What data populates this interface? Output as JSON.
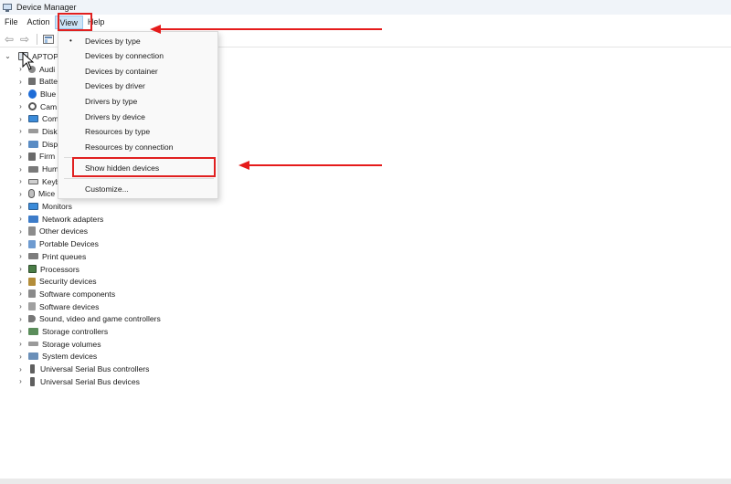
{
  "window": {
    "title": "Device Manager",
    "icon": "device-manager-icon"
  },
  "menubar": [
    {
      "label": "File",
      "active": false
    },
    {
      "label": "Action",
      "active": false
    },
    {
      "label": "View",
      "active": true
    },
    {
      "label": "Help",
      "active": false
    }
  ],
  "toolbar": [
    {
      "icon": "back-arrow-icon",
      "glyph": "⇦"
    },
    {
      "icon": "forward-arrow-icon",
      "glyph": "⇨"
    },
    {
      "icon": "properties-icon",
      "glyph": ""
    }
  ],
  "tree": {
    "root": {
      "label": "LAPTOP",
      "visible_label": "APTOP",
      "expanded": true,
      "icon": "computer-icon"
    },
    "children": [
      {
        "label": "Audi",
        "icon": "audio-icon"
      },
      {
        "label": "Batte",
        "icon": "battery-icon"
      },
      {
        "label": "Blue",
        "icon": "bluetooth-icon"
      },
      {
        "label": "Cam",
        "icon": "camera-icon"
      },
      {
        "label": "Com",
        "icon": "computer-icon"
      },
      {
        "label": "Disk",
        "icon": "disk-drive-icon"
      },
      {
        "label": "Disp",
        "icon": "display-adapter-icon"
      },
      {
        "label": "Firm",
        "icon": "firmware-icon"
      },
      {
        "label": "Hum",
        "icon": "hid-icon"
      },
      {
        "label": "Keyb",
        "icon": "keyboard-icon"
      },
      {
        "label": "Mice",
        "icon": "mouse-icon"
      },
      {
        "label": "Monitors",
        "icon": "monitor-icon"
      },
      {
        "label": "Network adapters",
        "icon": "network-adapter-icon"
      },
      {
        "label": "Other devices",
        "icon": "other-devices-icon"
      },
      {
        "label": "Portable Devices",
        "icon": "portable-device-icon"
      },
      {
        "label": "Print queues",
        "icon": "printer-icon"
      },
      {
        "label": "Processors",
        "icon": "processor-icon"
      },
      {
        "label": "Security devices",
        "icon": "security-device-icon"
      },
      {
        "label": "Software components",
        "icon": "software-component-icon"
      },
      {
        "label": "Software devices",
        "icon": "software-device-icon"
      },
      {
        "label": "Sound, video and game controllers",
        "icon": "sound-icon"
      },
      {
        "label": "Storage controllers",
        "icon": "storage-controller-icon"
      },
      {
        "label": "Storage volumes",
        "icon": "storage-volume-icon"
      },
      {
        "label": "System devices",
        "icon": "system-device-icon"
      },
      {
        "label": "Universal Serial Bus controllers",
        "icon": "usb-icon"
      },
      {
        "label": "Universal Serial Bus devices",
        "icon": "usb-icon"
      }
    ]
  },
  "view_menu": {
    "items": [
      {
        "label": "Devices by type",
        "checked": true
      },
      {
        "label": "Devices by connection",
        "checked": false
      },
      {
        "label": "Devices by container",
        "checked": false
      },
      {
        "label": "Devices by driver",
        "checked": false
      },
      {
        "label": "Drivers by type",
        "checked": false
      },
      {
        "label": "Drivers by device",
        "checked": false
      },
      {
        "label": "Resources by type",
        "checked": false
      },
      {
        "label": "Resources by connection",
        "checked": false
      },
      {
        "label": "Show hidden devices",
        "checked": false,
        "highlighted": true
      },
      {
        "label": "Customize...",
        "checked": false
      }
    ],
    "check_glyph": "•"
  },
  "annotations": {
    "color": "#e51b1b",
    "arrows": [
      "pointing to View menu",
      "pointing to Show hidden devices"
    ]
  }
}
